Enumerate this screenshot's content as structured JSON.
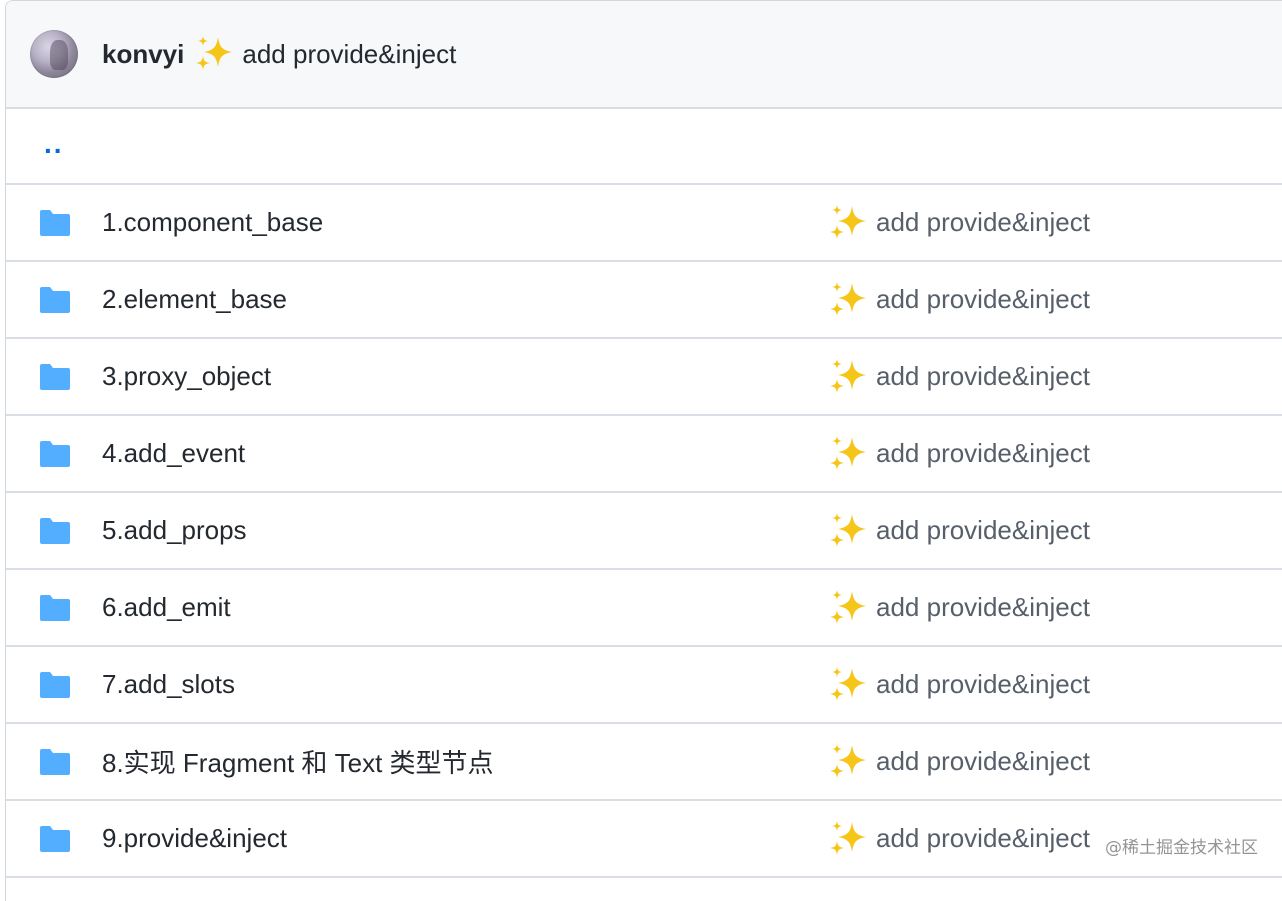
{
  "header": {
    "author": "konvyi",
    "message": "add provide&inject",
    "emoji": "sparkles"
  },
  "parent_link": "..",
  "files": [
    {
      "name": "1.component_base",
      "message": "add provide&inject",
      "icon": "folder-icon",
      "emoji": "sparkles"
    },
    {
      "name": "2.element_base",
      "message": "add provide&inject",
      "icon": "folder-icon",
      "emoji": "sparkles"
    },
    {
      "name": "3.proxy_object",
      "message": "add provide&inject",
      "icon": "folder-icon",
      "emoji": "sparkles"
    },
    {
      "name": "4.add_event",
      "message": "add provide&inject",
      "icon": "folder-icon",
      "emoji": "sparkles"
    },
    {
      "name": "5.add_props",
      "message": "add provide&inject",
      "icon": "folder-icon",
      "emoji": "sparkles"
    },
    {
      "name": "6.add_emit",
      "message": "add provide&inject",
      "icon": "folder-icon",
      "emoji": "sparkles"
    },
    {
      "name": "7.add_slots",
      "message": "add provide&inject",
      "icon": "folder-icon",
      "emoji": "sparkles"
    },
    {
      "name": "8.实现 Fragment 和 Text 类型节点",
      "message": "add provide&inject",
      "icon": "folder-icon",
      "emoji": "sparkles"
    },
    {
      "name": "9.provide&inject",
      "message": "add provide&inject",
      "icon": "folder-icon",
      "emoji": "sparkles"
    }
  ],
  "watermark": "@稀土掘金技术社区",
  "colors": {
    "folder": "#54aeff",
    "link": "#0969da",
    "header_bg": "#f6f8fa",
    "border": "#d8dee4",
    "sparkle": "#f5c518"
  }
}
